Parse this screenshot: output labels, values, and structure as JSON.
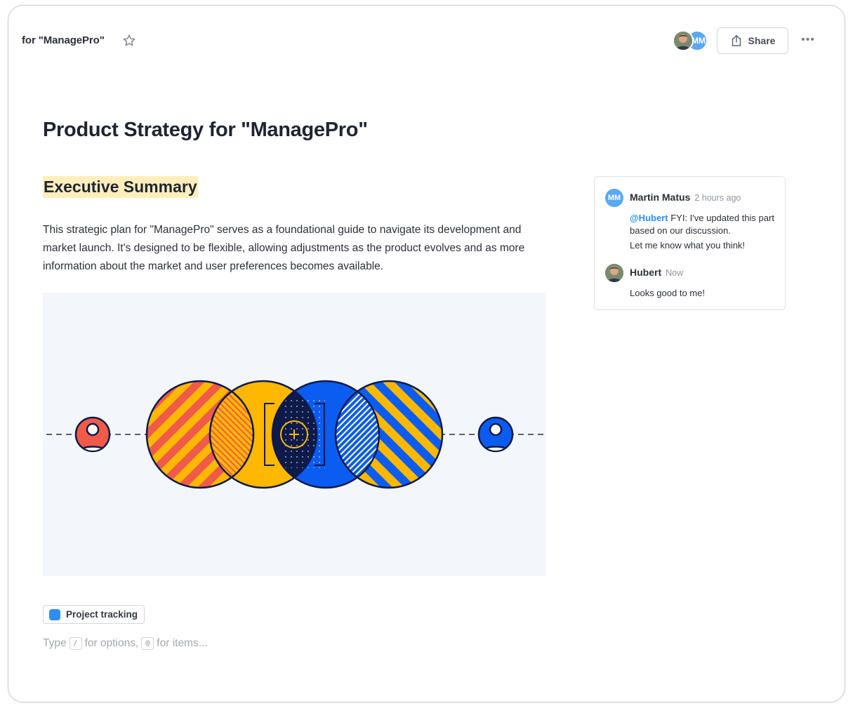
{
  "topbar": {
    "title": "for \"ManagePro\"",
    "avatar_initials": "MM",
    "share_label": "Share",
    "more_label": "•••"
  },
  "document": {
    "title": "Product Strategy for \"ManagePro\"",
    "section_heading": "Executive Summary",
    "paragraph": "This strategic plan for \"ManagePro\" serves as a foundational guide to navigate its development and market launch. It's designed to be flexible, allowing adjustments as the product evolves and as more information about the market and user preferences becomes available.",
    "tag": {
      "label": "Project tracking",
      "color": "#2e8df6"
    },
    "hint": {
      "before": "Type",
      "key1": "/",
      "middle": "for options,",
      "key2": "@",
      "after": "for items..."
    }
  },
  "comments": [
    {
      "initials": "MM",
      "author": "Martin Matus",
      "time": "2 hours ago",
      "mention": "@Hubert",
      "text": "FYI: I've updated this part based on our discussion.",
      "text2": "Let me know what you think!"
    },
    {
      "author": "Hubert",
      "time": "Now",
      "text": "Looks good to me!"
    }
  ],
  "colors": {
    "accent_blue": "#2e8df6",
    "highlight": "#fdeebc",
    "illus_red": "#ef5a49",
    "illus_yellow": "#ffb800",
    "illus_blue": "#0b5cf0",
    "illus_navy": "#0e1a4a"
  },
  "icons": [
    "star-icon",
    "share-icon",
    "more-icon",
    "user-icon",
    "plus-icon"
  ]
}
